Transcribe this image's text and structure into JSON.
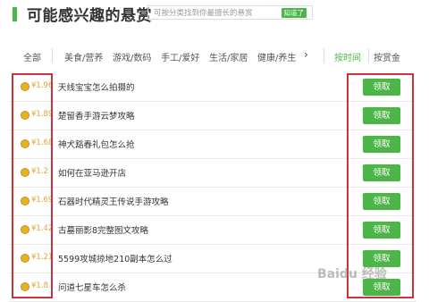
{
  "header": {
    "title": "可能感兴趣的悬赏",
    "hint": "可按分类找到你最擅长的悬赏",
    "know_button": "知道了"
  },
  "categories": {
    "all": "全部",
    "items": [
      "美食/营养",
      "游戏/数码",
      "手工/爱好",
      "生活/家居",
      "健康/养生"
    ],
    "more": "›",
    "sort_time": "按时间",
    "sort_reward": "按赏金"
  },
  "rewards": [
    {
      "price": "¥1.96",
      "question": "天线宝宝怎么拍摄的",
      "action": "领取"
    },
    {
      "price": "¥1.89",
      "question": "楚留香手游云梦攻略",
      "action": "领取"
    },
    {
      "price": "¥1.68",
      "question": "神犬豁春礼包怎么抢",
      "action": "领取"
    },
    {
      "price": "¥1.2",
      "question": "如何在亚马逊开店",
      "action": "领取"
    },
    {
      "price": "¥1.69",
      "question": "石器时代精灵王传说手游攻略",
      "action": "领取"
    },
    {
      "price": "¥1.42",
      "question": "古墓丽影8完整图文攻略",
      "action": "领取"
    },
    {
      "price": "¥1.21",
      "question": "5599攻城掠地210副本怎么过",
      "action": "领取"
    },
    {
      "price": "¥1.8",
      "question": "问道七星车怎么杀",
      "action": "领取"
    }
  ],
  "colors": {
    "accent": "#4cb648",
    "highlight": "#c9333e",
    "price": "#d9a43a"
  }
}
